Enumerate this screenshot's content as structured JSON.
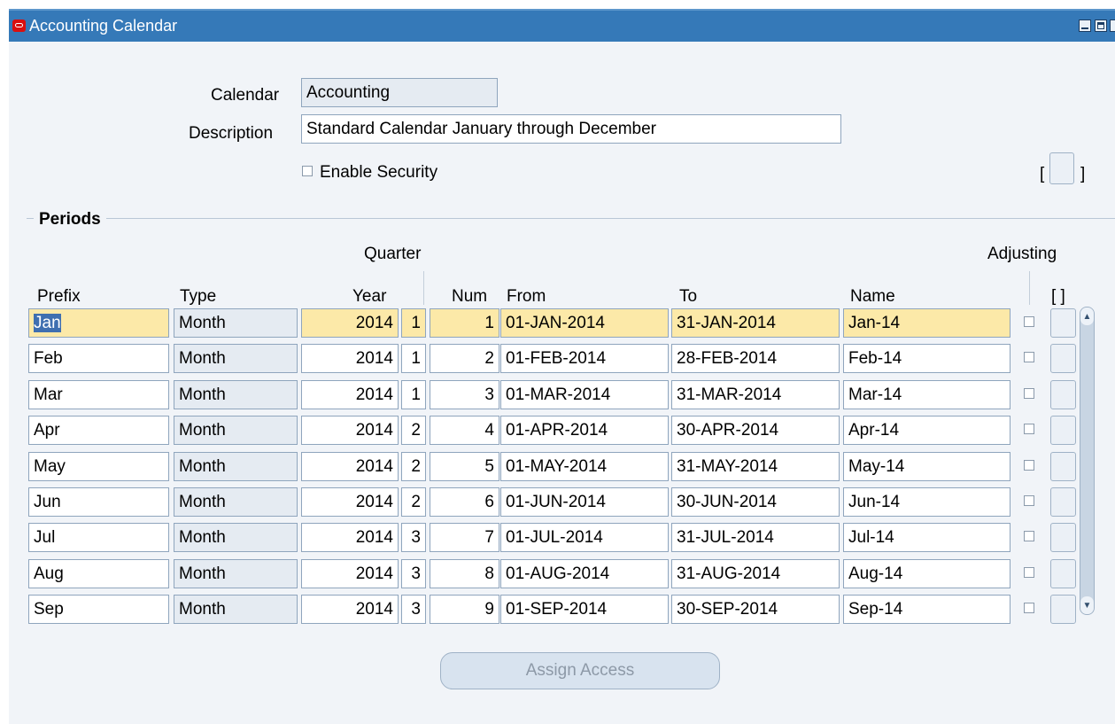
{
  "window": {
    "title": "Accounting Calendar"
  },
  "header": {
    "calendar_label": "Calendar",
    "calendar_value": "Accounting",
    "description_label": "Description",
    "description_value": "Standard Calendar January through December",
    "enable_security_label": "Enable Security",
    "bracket_open": "[",
    "bracket_close": "]"
  },
  "periods": {
    "section_title": "Periods",
    "quarter_label": "Quarter",
    "adjusting_label": "Adjusting",
    "bracket_label": "[ ]",
    "columns": {
      "prefix": "Prefix",
      "type": "Type",
      "year": "Year",
      "num": "Num",
      "from": "From",
      "to": "To",
      "name": "Name"
    },
    "rows": [
      {
        "prefix": "Jan",
        "type": "Month",
        "year": "2014",
        "quarter": "1",
        "num": "1",
        "from": "01-JAN-2014",
        "to": "31-JAN-2014",
        "name": "Jan-14"
      },
      {
        "prefix": "Feb",
        "type": "Month",
        "year": "2014",
        "quarter": "1",
        "num": "2",
        "from": "01-FEB-2014",
        "to": "28-FEB-2014",
        "name": "Feb-14"
      },
      {
        "prefix": "Mar",
        "type": "Month",
        "year": "2014",
        "quarter": "1",
        "num": "3",
        "from": "01-MAR-2014",
        "to": "31-MAR-2014",
        "name": "Mar-14"
      },
      {
        "prefix": "Apr",
        "type": "Month",
        "year": "2014",
        "quarter": "2",
        "num": "4",
        "from": "01-APR-2014",
        "to": "30-APR-2014",
        "name": "Apr-14"
      },
      {
        "prefix": "May",
        "type": "Month",
        "year": "2014",
        "quarter": "2",
        "num": "5",
        "from": "01-MAY-2014",
        "to": "31-MAY-2014",
        "name": "May-14"
      },
      {
        "prefix": "Jun",
        "type": "Month",
        "year": "2014",
        "quarter": "2",
        "num": "6",
        "from": "01-JUN-2014",
        "to": "30-JUN-2014",
        "name": "Jun-14"
      },
      {
        "prefix": "Jul",
        "type": "Month",
        "year": "2014",
        "quarter": "3",
        "num": "7",
        "from": "01-JUL-2014",
        "to": "31-JUL-2014",
        "name": "Jul-14"
      },
      {
        "prefix": "Aug",
        "type": "Month",
        "year": "2014",
        "quarter": "3",
        "num": "8",
        "from": "01-AUG-2014",
        "to": "31-AUG-2014",
        "name": "Aug-14"
      },
      {
        "prefix": "Sep",
        "type": "Month",
        "year": "2014",
        "quarter": "3",
        "num": "9",
        "from": "01-SEP-2014",
        "to": "30-SEP-2014",
        "name": "Sep-14"
      }
    ]
  },
  "footer": {
    "assign_access_label": "Assign Access"
  },
  "icons": {
    "app": "oracle-logo-icon",
    "minimize": "minimize-icon",
    "maximize": "maximize-icon",
    "close": "close-icon",
    "scroll_up": "scroll-up-icon",
    "scroll_down": "scroll-down-icon"
  },
  "colors": {
    "titlebar": "#3579b8",
    "panel": "#f1f4f8",
    "current_row": "#fce9a8",
    "readonly": "#e5ebf2"
  }
}
